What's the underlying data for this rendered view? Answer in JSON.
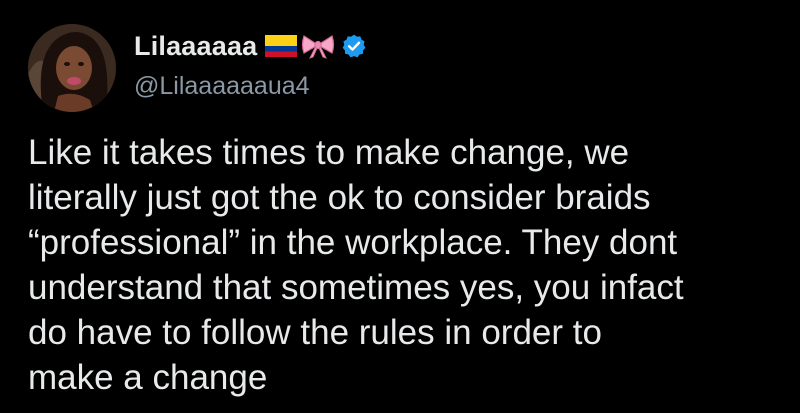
{
  "tweet": {
    "author": {
      "display_name": "Lilaaaaaa",
      "handle": "@Lilaaaaaaua4",
      "name_emojis": [
        "colombia-flag-icon",
        "ribbon-bow-icon"
      ],
      "verified_icon": "verified-badge-icon"
    },
    "text": "Like it takes times to make change, we\nliterally just got the ok to consider braids\n“professional” in the workplace. They dont\nunderstand that sometimes yes, you infact\ndo have to follow the rules in order to\nmake a change"
  },
  "colors": {
    "background": "#000000",
    "text": "#e7e9ea",
    "secondary_text": "#8b98a5",
    "verified": "#1d9bf0",
    "flag_yellow": "#fcd116",
    "flag_blue": "#003893",
    "flag_red": "#ce1126",
    "bow_pink": "#f7a8c8"
  }
}
